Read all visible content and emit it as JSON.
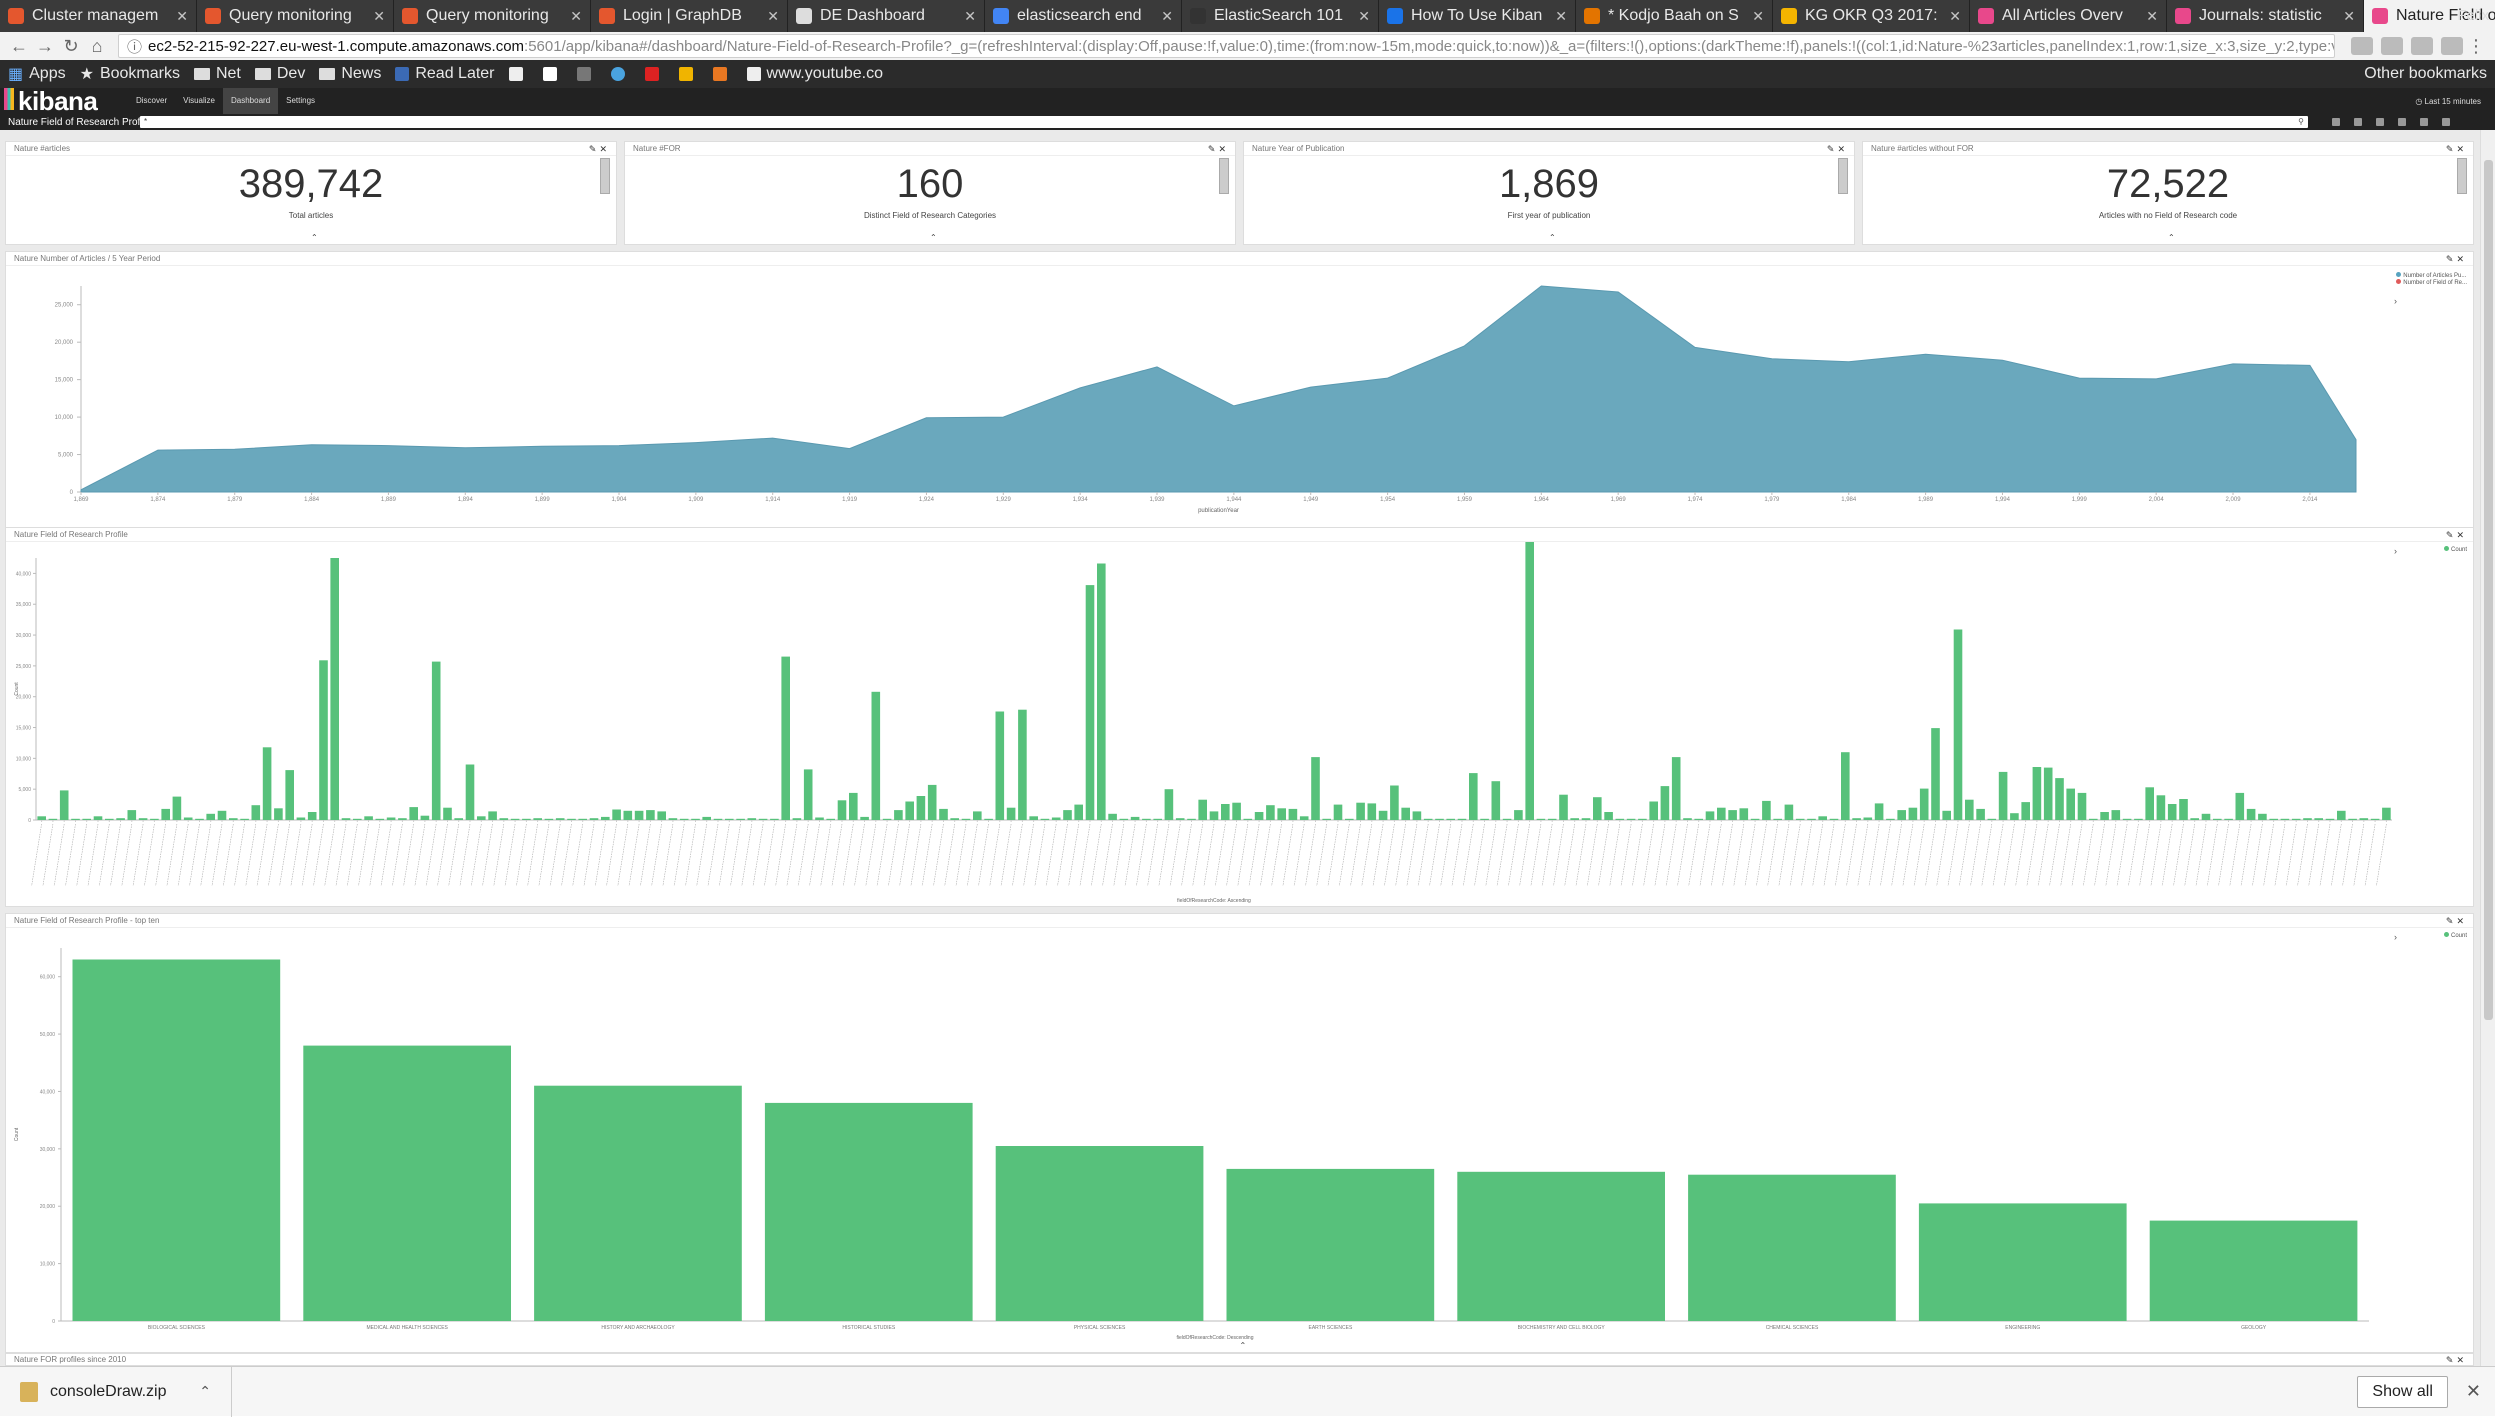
{
  "browser": {
    "tabs": [
      {
        "label": "Cluster managem",
        "color": "#e4572e",
        "active": false
      },
      {
        "label": "Query monitoring",
        "color": "#e4572e",
        "active": false
      },
      {
        "label": "Query monitoring",
        "color": "#e4572e",
        "active": false
      },
      {
        "label": "Login | GraphDB",
        "color": "#e4572e",
        "active": false
      },
      {
        "label": "DE Dashboard",
        "color": "#dddddd",
        "active": false
      },
      {
        "label": "elasticsearch end",
        "color": "#4285f4",
        "active": false
      },
      {
        "label": "ElasticSearch 101",
        "color": "#333333",
        "active": false
      },
      {
        "label": "How To Use Kiban",
        "color": "#1a73e8",
        "active": false
      },
      {
        "label": "* Kodjo Baah on S",
        "color": "#e37400",
        "active": false
      },
      {
        "label": "KG OKR Q3 2017:",
        "color": "#f4b400",
        "active": false
      },
      {
        "label": "All Articles Overv",
        "color": "#e8488b",
        "active": false
      },
      {
        "label": "Journals: statistic",
        "color": "#e8488b",
        "active": false
      },
      {
        "label": "Nature Field of Re",
        "color": "#e8488b",
        "active": true
      }
    ],
    "user": "Felix",
    "url_host": "ec2-52-215-92-227.eu-west-1.compute.amazonaws.com",
    "url_path": ":5601/app/kibana#/dashboard/Nature-Field-of-Research-Profile?_g=(refreshInterval:(display:Off,pause:!f,value:0),time:(from:now-15m,mode:quick,to:now))&_a=(filters:!(),options:(darkTheme:!f),panels:!((col:1,id:Nature-%23articles,panelIndex:1,row:1,size_x:3,size_y:2,type:visualization),(c",
    "bookmarks": [
      "Apps",
      "Bookmarks",
      "Net",
      "Dev",
      "News",
      "Read Later",
      "www.youtube.co"
    ],
    "other_bookmarks": "Other bookmarks"
  },
  "kibana": {
    "logo": "kibana",
    "nav": [
      "Discover",
      "Visualize",
      "Dashboard",
      "Settings"
    ],
    "active_nav": "Dashboard",
    "time_range": "Last 15 minutes",
    "dashboard_title": "Nature Field of Research Profile",
    "query": "*"
  },
  "metrics": [
    {
      "title": "Nature #articles",
      "value": "389,742",
      "label": "Total articles"
    },
    {
      "title": "Nature #FOR",
      "value": "160",
      "label": "Distinct Field of Research Categories"
    },
    {
      "title": "Nature Year of Publication",
      "value": "1,869",
      "label": "First year of publication"
    },
    {
      "title": "Nature #articles without FOR",
      "value": "72,522",
      "label": "Articles with no Field of Research code"
    }
  ],
  "area_panel": {
    "title": "Nature Number of Articles / 5 Year Period",
    "legend": [
      "Number of Articles Pu...",
      "Number of Field of Re..."
    ],
    "legend_colors": [
      "#57a3c0",
      "#e05a5a"
    ],
    "xlabel": "publicationYear",
    "yticks": [
      "0",
      "5,000",
      "10,000",
      "15,000",
      "20,000",
      "25,000"
    ]
  },
  "for_panel": {
    "title": "Nature Field of Research Profile",
    "legend": "Count",
    "xlabel": "fieldOfResearchCode: Ascending",
    "ylabel": "Count",
    "yticks": [
      "0",
      "5,000",
      "10,000",
      "15,000",
      "20,000",
      "25,000",
      "30,000",
      "35,000",
      "40,000"
    ]
  },
  "top_panel": {
    "title": "Nature Field of Research Profile - top ten",
    "legend": "Count",
    "xlabel": "fieldOfResearchCode: Descending",
    "ylabel": "Count",
    "yticks": [
      "0",
      "10,000",
      "20,000",
      "30,000",
      "40,000",
      "50,000",
      "60,000"
    ]
  },
  "bottom_panel": {
    "title": "Nature FOR profiles since 2010"
  },
  "downloads": {
    "file": "consoleDraw.zip",
    "show_all": "Show all"
  },
  "chart_data": [
    {
      "type": "area",
      "x": [
        1869,
        1874,
        1879,
        1884,
        1889,
        1894,
        1899,
        1904,
        1909,
        1914,
        1919,
        1924,
        1929,
        1934,
        1939,
        1944,
        1949,
        1954,
        1959,
        1964,
        1969,
        1974,
        1979,
        1984,
        1989,
        1994,
        1999,
        2004,
        2009,
        2014,
        2017
      ],
      "x_ticks": [
        "1,869",
        "1,874",
        "1,879",
        "1,884",
        "1,889",
        "1,894",
        "1,899",
        "1,904",
        "1,909",
        "1,914",
        "1,919",
        "1,924",
        "1,929",
        "1,934",
        "1,939",
        "1,944",
        "1,949",
        "1,954",
        "1,959",
        "1,964",
        "1,969",
        "1,974",
        "1,979",
        "1,984",
        "1,989",
        "1,994",
        "1,999",
        "2,004",
        "2,009",
        "2,014"
      ],
      "values": [
        300,
        5600,
        5700,
        6300,
        6200,
        5900,
        6100,
        6200,
        6600,
        7200,
        5800,
        9900,
        10000,
        13900,
        16700,
        11500,
        14000,
        15200,
        19500,
        27500,
        26700,
        19300,
        17800,
        17400,
        18400,
        17600,
        15200,
        15100,
        17100,
        16900,
        7000
      ],
      "ylim": [
        0,
        27500
      ]
    },
    {
      "type": "bar",
      "series_name": "Count",
      "category_count": 160,
      "values": [
        600,
        200,
        4800,
        200,
        200,
        600,
        200,
        300,
        1600,
        300,
        200,
        1800,
        3800,
        400,
        200,
        1000,
        1500,
        300,
        200,
        2400,
        11800,
        1900,
        8100,
        400,
        1300,
        25900,
        42500,
        300,
        200,
        600,
        200,
        400,
        300,
        2100,
        700,
        25700,
        2000,
        300,
        9000,
        600,
        1400,
        300,
        200,
        200,
        300,
        200,
        300,
        200,
        200,
        300,
        500,
        1700,
        1500,
        1500,
        1600,
        1400,
        300,
        200,
        200,
        500,
        200,
        200,
        200,
        300,
        200,
        200,
        26500,
        300,
        8200,
        400,
        200,
        3200,
        4400,
        500,
        20800,
        200,
        1600,
        3000,
        3900,
        5700,
        1800,
        300,
        200,
        1400,
        200,
        17600,
        2000,
        17900,
        600,
        200,
        400,
        1600,
        2500,
        38100,
        41600,
        1000,
        200,
        500,
        200,
        200,
        5000,
        300,
        200,
        3300,
        1400,
        2600,
        2800,
        200,
        1300,
        2400,
        1900,
        1800,
        600,
        10200,
        200,
        2500,
        200,
        2800,
        2700,
        1500,
        5600,
        2000,
        1400,
        200,
        200,
        200,
        200,
        7600,
        200,
        6300,
        200,
        1600,
        48100,
        200,
        200,
        4100,
        300,
        300,
        3700,
        1300,
        200,
        200,
        200,
        3000,
        5500,
        10200,
        300,
        200,
        1400,
        2000,
        1600,
        1900,
        200,
        3100,
        200,
        2500,
        200,
        200,
        600,
        200,
        11000,
        300,
        400,
        2700,
        200,
        1600,
        2000,
        5100,
        14900,
        1500,
        30900,
        3300,
        1800,
        200,
        7800,
        1100,
        2900,
        8600,
        8500,
        6800,
        5100,
        4400,
        200,
        1300,
        1600,
        200,
        200,
        5300,
        4000,
        2600,
        3400,
        300,
        1000,
        200,
        200,
        4400,
        1800,
        1000,
        200,
        200,
        200,
        300,
        300,
        200,
        1500,
        200,
        300,
        200,
        2000
      ],
      "ylim": [
        0,
        42500
      ]
    },
    {
      "type": "bar",
      "series_name": "Count",
      "categories": [
        "BIOLOGICAL SCIENCES",
        "MEDICAL AND HEALTH SCIENCES",
        "HISTORY AND ARCHAEOLOGY",
        "HISTORICAL STUDIES",
        "PHYSICAL SCIENCES",
        "EARTH SCIENCES",
        "BIOCHEMISTRY AND CELL BIOLOGY",
        "CHEMICAL SCIENCES",
        "ENGINEERING",
        "GEOLOGY"
      ],
      "values": [
        63000,
        48000,
        41000,
        38000,
        30500,
        26500,
        26000,
        25500,
        20500,
        17500
      ],
      "ylim": [
        0,
        65000
      ]
    }
  ]
}
